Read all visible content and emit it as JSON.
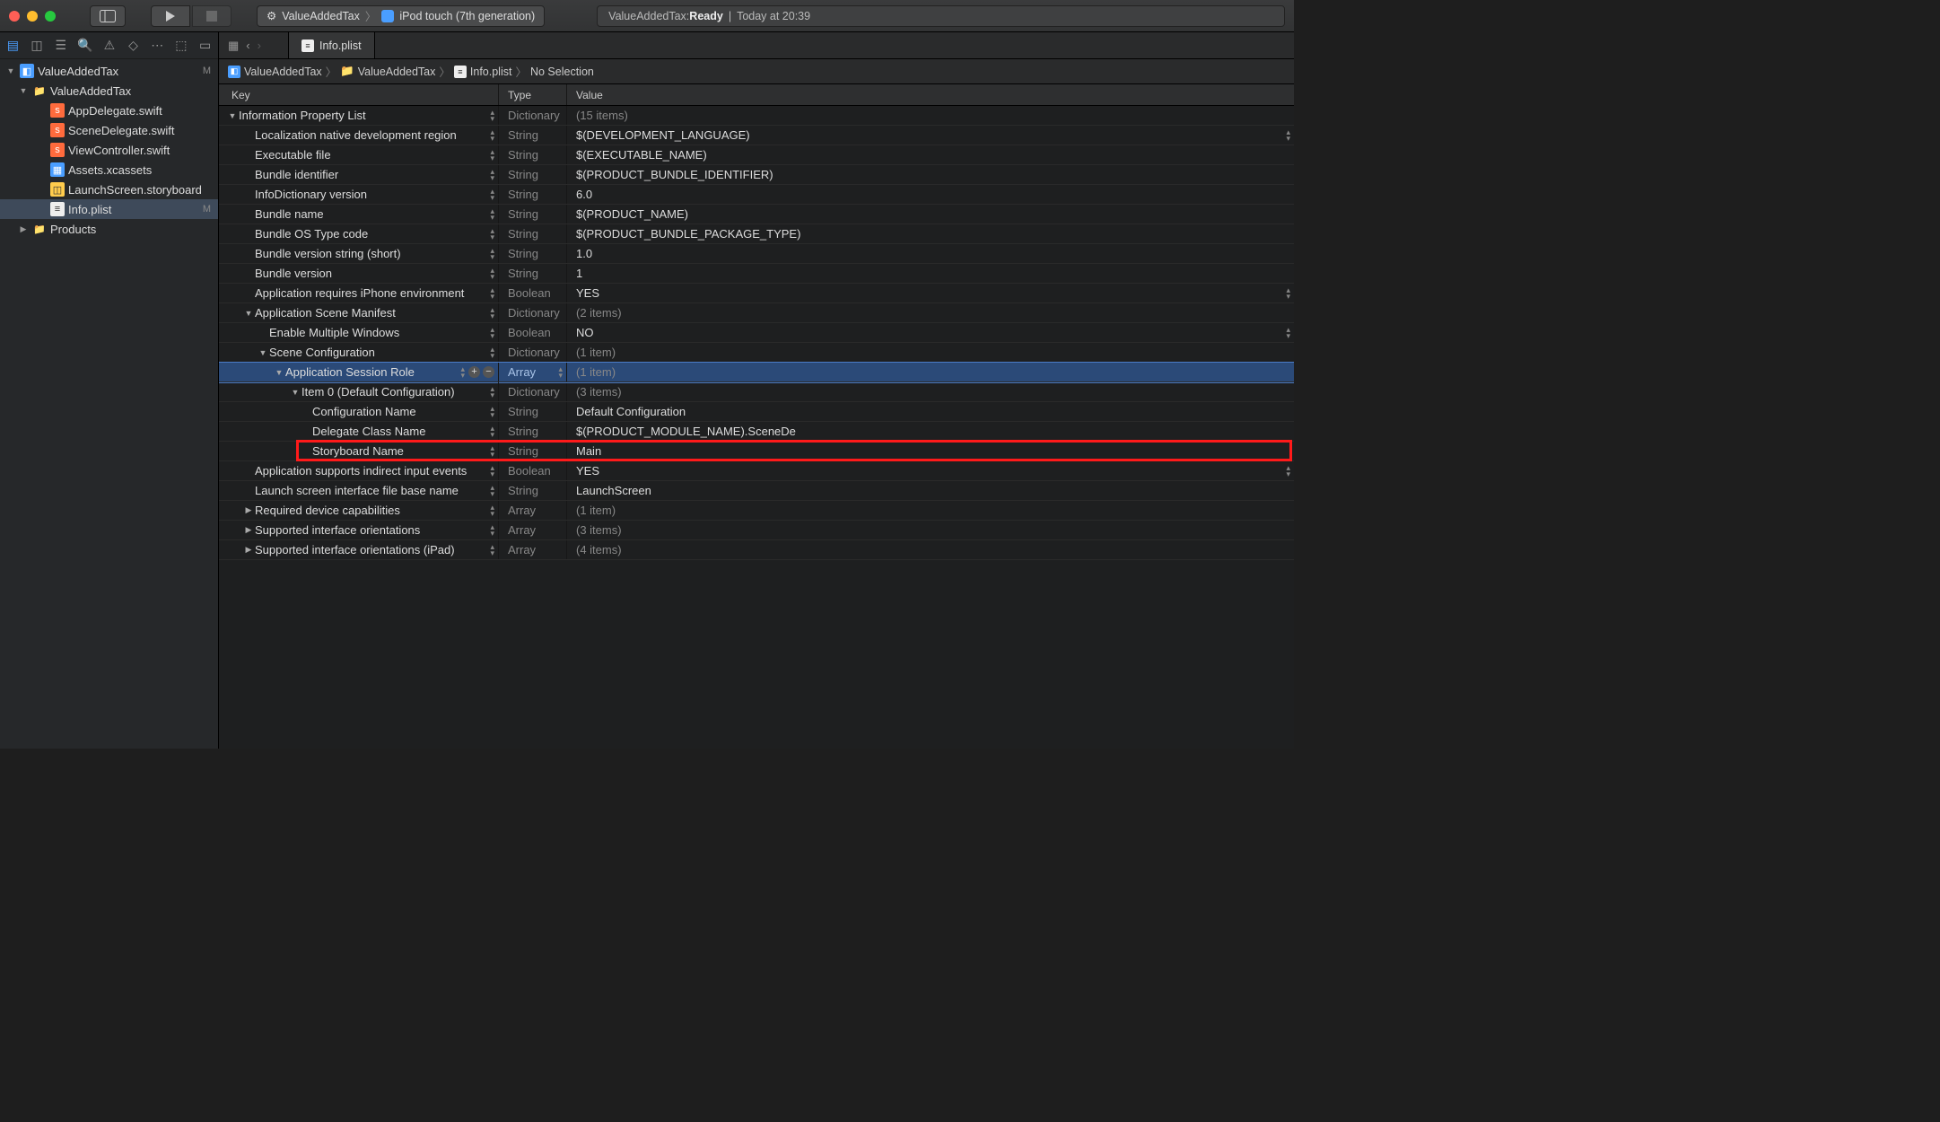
{
  "toolbar": {
    "scheme_target": "ValueAddedTax",
    "scheme_device": "iPod touch (7th generation)",
    "status_prefix": "ValueAddedTax: ",
    "status_state": "Ready",
    "status_time": "Today at 20:39"
  },
  "sidebar": {
    "project": "ValueAddedTax",
    "project_badge": "M",
    "folder": "ValueAddedTax",
    "files": {
      "appdelegate": "AppDelegate.swift",
      "scenedelegate": "SceneDelegate.swift",
      "viewcontroller": "ViewController.swift",
      "assets": "Assets.xcassets",
      "launch": "LaunchScreen.storyboard",
      "infoplist": "Info.plist",
      "infoplist_badge": "M",
      "products": "Products"
    }
  },
  "tab": {
    "label": "Info.plist"
  },
  "jumpbar": {
    "a": "ValueAddedTax",
    "b": "ValueAddedTax",
    "c": "Info.plist",
    "d": "No Selection"
  },
  "columns": {
    "key": "Key",
    "type": "Type",
    "value": "Value"
  },
  "rows": [
    {
      "lvl": 0,
      "disc": "▼",
      "key": "Information Property List",
      "type": "Dictionary",
      "val": "(15 items)",
      "dim": true
    },
    {
      "lvl": 1,
      "key": "Localization native development region",
      "type": "String",
      "val": "$(DEVELOPMENT_LANGUAGE)",
      "stepR": true
    },
    {
      "lvl": 1,
      "key": "Executable file",
      "type": "String",
      "val": "$(EXECUTABLE_NAME)"
    },
    {
      "lvl": 1,
      "key": "Bundle identifier",
      "type": "String",
      "val": "$(PRODUCT_BUNDLE_IDENTIFIER)"
    },
    {
      "lvl": 1,
      "key": "InfoDictionary version",
      "type": "String",
      "val": "6.0"
    },
    {
      "lvl": 1,
      "key": "Bundle name",
      "type": "String",
      "val": "$(PRODUCT_NAME)"
    },
    {
      "lvl": 1,
      "key": "Bundle OS Type code",
      "type": "String",
      "val": "$(PRODUCT_BUNDLE_PACKAGE_TYPE)"
    },
    {
      "lvl": 1,
      "key": "Bundle version string (short)",
      "type": "String",
      "val": "1.0"
    },
    {
      "lvl": 1,
      "key": "Bundle version",
      "type": "String",
      "val": "1"
    },
    {
      "lvl": 1,
      "key": "Application requires iPhone environment",
      "type": "Boolean",
      "val": "YES",
      "stepR": true
    },
    {
      "lvl": 1,
      "disc": "▼",
      "key": "Application Scene Manifest",
      "type": "Dictionary",
      "val": "(2 items)",
      "dim": true
    },
    {
      "lvl": 2,
      "key": "Enable Multiple Windows",
      "type": "Boolean",
      "val": "NO",
      "stepR": true
    },
    {
      "lvl": 2,
      "disc": "▼",
      "key": "Scene Configuration",
      "type": "Dictionary",
      "val": "(1 item)",
      "dim": true
    },
    {
      "lvl": 3,
      "disc": "▼",
      "key": "Application Session Role",
      "type": "Array",
      "val": "(1 item)",
      "dim": true,
      "selected": true,
      "pm": true
    },
    {
      "lvl": 4,
      "disc": "▼",
      "key": "Item 0 (Default Configuration)",
      "type": "Dictionary",
      "val": "(3 items)",
      "dim": true
    },
    {
      "lvl": 5,
      "key": "Configuration Name",
      "type": "String",
      "val": "Default Configuration"
    },
    {
      "lvl": 5,
      "key": "Delegate Class Name",
      "type": "String",
      "val": "$(PRODUCT_MODULE_NAME).SceneDe"
    },
    {
      "lvl": 5,
      "key": "Storyboard Name",
      "type": "String",
      "val": "Main",
      "highlight": true
    },
    {
      "lvl": 1,
      "key": "Application supports indirect input events",
      "type": "Boolean",
      "val": "YES",
      "stepR": true
    },
    {
      "lvl": 1,
      "key": "Launch screen interface file base name",
      "type": "String",
      "val": "LaunchScreen"
    },
    {
      "lvl": 1,
      "disc": "▶",
      "key": "Required device capabilities",
      "type": "Array",
      "val": "(1 item)",
      "dim": true
    },
    {
      "lvl": 1,
      "disc": "▶",
      "key": "Supported interface orientations",
      "type": "Array",
      "val": "(3 items)",
      "dim": true
    },
    {
      "lvl": 1,
      "disc": "▶",
      "key": "Supported interface orientations (iPad)",
      "type": "Array",
      "val": "(4 items)",
      "dim": true
    }
  ]
}
